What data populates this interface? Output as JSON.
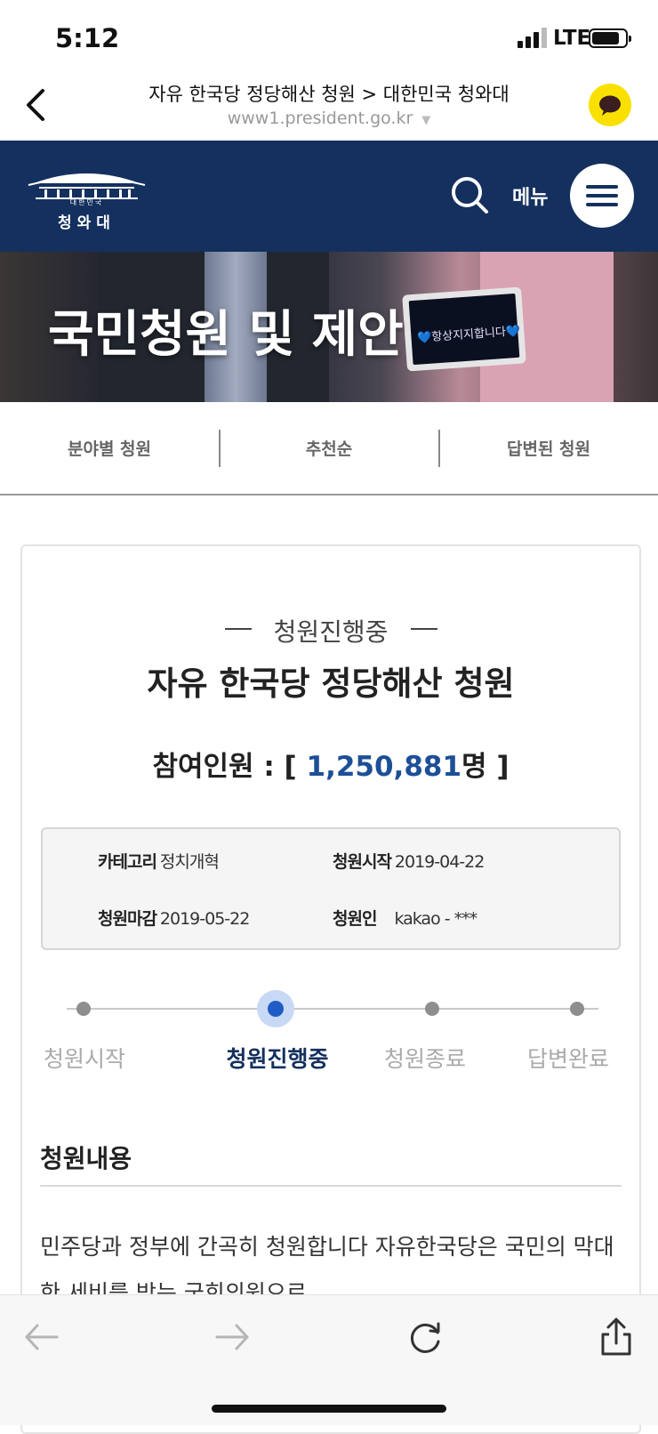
{
  "status_bar": {
    "time": "5:12",
    "network": "LTE"
  },
  "browser": {
    "page_title": "자유 한국당 정당해산 청원 > 대한민국 청와대",
    "url": "www1.president.go.kr"
  },
  "site_header": {
    "logo_sub": "대한민국",
    "logo_name": "청와대",
    "menu_label": "메뉴"
  },
  "banner": {
    "title": "국민청원 및 제안",
    "tablet_text": "💙항상지지합니다💙"
  },
  "tabs": [
    "분야별 청원",
    "추천순",
    "답변된 청원"
  ],
  "petition": {
    "status": "청원진행중",
    "title": "자유 한국당 정당해산 청원",
    "participants_label": "참여인원 : [",
    "participants_count": "1,250,881",
    "participants_unit": "명 ]",
    "info": {
      "category_label": "카테고리",
      "category_value": "정치개혁",
      "start_label": "청원시작",
      "start_value": "2019-04-22",
      "end_label": "청원마감",
      "end_value": "2019-05-22",
      "petitioner_label": "청원인",
      "petitioner_value": "kakao - ***"
    },
    "steps": [
      "청원시작",
      "청원진행중",
      "청원종료",
      "답변완료"
    ],
    "current_step_index": 1,
    "content_heading": "청원내용",
    "content_text": "민주당과 정부에 간곡히 청원합니다 자유한국당은 국민의 막대한 세비를 받는 국회의원으로"
  },
  "colors": {
    "header_navy": "#14305e",
    "accent_blue": "#1d4f97",
    "kakao_yellow": "#f9e000"
  },
  "toolbar_icons": [
    "back-arrow-icon",
    "forward-arrow-icon",
    "reload-icon",
    "share-icon"
  ]
}
